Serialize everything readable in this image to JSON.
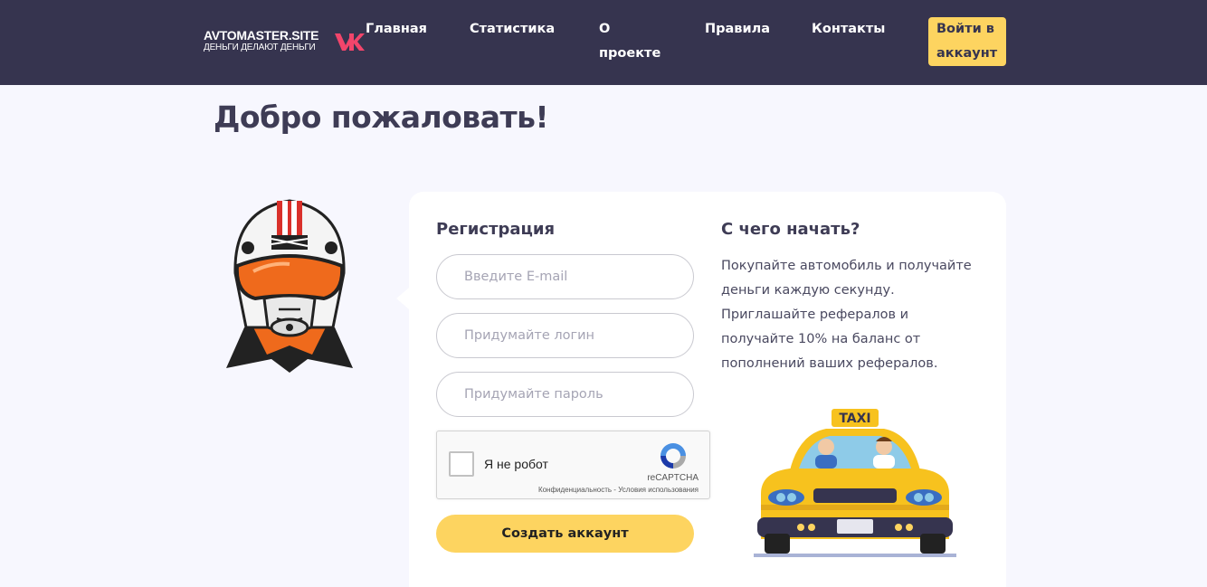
{
  "header": {
    "logo_title": "AVTOMASTER.SITE",
    "logo_subtitle": "ДЕНЬГИ ДЕЛАЮТ ДЕНЬГИ",
    "nav": [
      {
        "label": "Главная"
      },
      {
        "label": "Статистика"
      },
      {
        "label": "О проекте"
      },
      {
        "label": "Правила"
      },
      {
        "label": "Контакты"
      }
    ],
    "login_label": "Войти в аккаунт"
  },
  "page": {
    "title": "Добро пожаловать!"
  },
  "registration": {
    "title": "Регистрация",
    "email_placeholder": "Введите E-mail",
    "login_placeholder": "Придумайте логин",
    "password_placeholder": "Придумайте пароль",
    "captcha": {
      "label": "Я не робот",
      "brand": "reCAPTCHA",
      "links": "Конфиденциальность - Условия использования"
    },
    "submit_label": "Создать аккаунт"
  },
  "start": {
    "title": "С чего начать?",
    "text": "Покупайте автомобиль и получайте деньги каждую секунду. Приглашайте рефералов и получайте 10% на баланс от пополнений ваших рефералов."
  },
  "illustrations": {
    "taxi_sign": "TAXI"
  },
  "colors": {
    "header_bg": "#36344f",
    "accent_yellow": "#fdd460",
    "page_bg": "#f7f7fe",
    "vk_pink": "#f2456b"
  },
  "icons": [
    "vk-icon",
    "recaptcha-icon"
  ]
}
